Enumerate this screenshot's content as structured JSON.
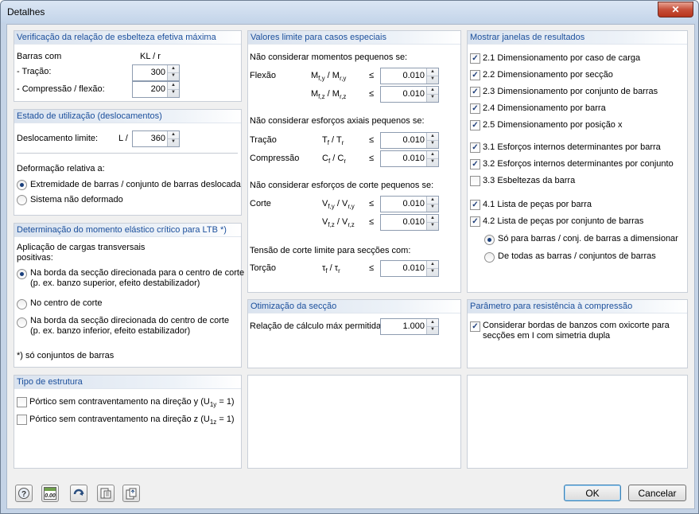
{
  "window": {
    "title": "Detalhes",
    "close_glyph": "✕"
  },
  "slenderness": {
    "title": "Verificação da relação de esbelteza efetiva máxima",
    "bars_with": "Barras com",
    "kl_r": "KL / r",
    "tension_label": "- Tração:",
    "tension_value": "300",
    "compression_label": "- Compressão / flexão:",
    "compression_value": "200"
  },
  "serviceability": {
    "title": "Estado de utilização (deslocamentos)",
    "limit_label": "Deslocamento limite:",
    "l_over": "L /",
    "limit_value": "360",
    "relative_label": "Deformação relativa a:",
    "options": [
      "Extremidade de barras / conjunto de barras deslocada",
      "Sistema não deformado"
    ],
    "selected": 0
  },
  "ltb": {
    "title": "Determinação do momento elástico crítico para LTB *)",
    "load_label_1": "Aplicação de cargas transversais",
    "load_label_2": "positivas:",
    "opt1_line1": "Na borda da secção direcionada para o centro de corte",
    "opt1_line2": "(p. ex. banzo superior, efeito destabilizador)",
    "opt2": "No centro de corte",
    "opt3_line1": "Na borda da secção direcionada do centro de corte",
    "opt3_line2": "(p. ex. banzo inferior, efeito estabilizador)",
    "selected": 0,
    "footnote": "*) só conjuntos de barras"
  },
  "structure": {
    "title": "Tipo de estrutura",
    "item1_text": "Pórtico sem contraventamento na direção y (U",
    "item1_sub": "1y",
    "item1_end": " = 1)",
    "item2_text": "Pórtico sem contraventamento na direção z (U",
    "item2_sub": "1z",
    "item2_end": " = 1)"
  },
  "limits": {
    "title": "Valores limite para casos especiais",
    "moments_label": "Não considerar momentos pequenos se:",
    "bending": "Flexão",
    "my_expr": "M",
    "my_sub": "f,y",
    "my_mid": " / M",
    "my_sub2": "r,y",
    "mz_sub": "f,z",
    "mz_sub2": "r,z",
    "le": "≤",
    "my_value": "0.010",
    "mz_value": "0.010",
    "axial_label": "Não considerar esforços axiais pequenos se:",
    "tension": "Tração",
    "t_expr": "T",
    "t_sub": "f",
    "t_sub2": "r",
    "t_value": "0.010",
    "compression": "Compressão",
    "c_expr": "C",
    "c_value": "0.010",
    "shear_label": "Não considerar esforços de corte pequenos se:",
    "shear": "Corte",
    "v_expr": "V",
    "vy_sub": "f,y",
    "vy_sub2": "r,y",
    "vy_value": "0.010",
    "vz_sub": "f,z",
    "vz_sub2": "r,z",
    "vz_value": "0.010",
    "torsion_label": "Tensão de corte limite para secções com:",
    "torsion": "Torção",
    "tau": "τ",
    "tau_value": "0.010"
  },
  "optimization": {
    "title": "Otimização da secção",
    "ratio_label": "Relação de cálculo máx permitida:",
    "ratio_value": "1.000"
  },
  "results": {
    "title": "Mostrar janelas de resultados",
    "items": [
      {
        "label": "2.1 Dimensionamento por caso de carga",
        "checked": true
      },
      {
        "label": "2.2 Dimensionamento por secção",
        "checked": true
      },
      {
        "label": "2.3 Dimensionamento por conjunto de barras",
        "checked": true
      },
      {
        "label": "2.4 Dimensionamento por barra",
        "checked": true
      },
      {
        "label": "2.5 Dimensionamento por posição x",
        "checked": true
      },
      {
        "label": "3.1 Esforços internos determinantes por barra",
        "checked": true
      },
      {
        "label": "3.2 Esforços internos determinantes por conjunto",
        "checked": true
      },
      {
        "label": "3.3 Esbeltezas da barra",
        "checked": false
      },
      {
        "label": "4.1 Lista de peças por barra",
        "checked": true
      },
      {
        "label": "4.2 Lista de peças por conjunto de barras",
        "checked": true
      }
    ],
    "sub_options": [
      "Só para barras / conj. de barras a dimensionar",
      "De todas as barras / conjuntos de barras"
    ],
    "sub_selected": 0
  },
  "compression_param": {
    "title": "Parâmetro para resistência à compressão",
    "line1": "Considerar bordas de banzos com oxicorte para",
    "line2": "secções em I com simetria dupla",
    "checked": true
  },
  "footer": {
    "ok": "OK",
    "cancel": "Cancelar",
    "units_icon_text": "0.00"
  },
  "check_glyph": "✓",
  "colors": {
    "panel_title": "#1b4f9c",
    "check": "#1c3d7a"
  }
}
